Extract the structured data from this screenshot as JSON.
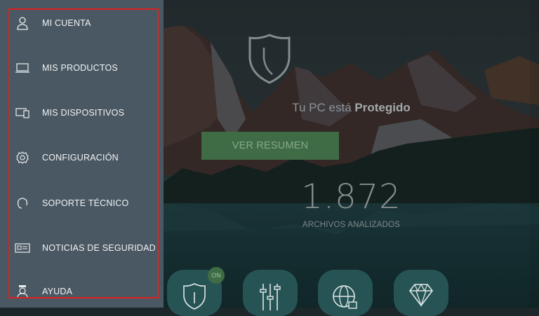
{
  "menu": {
    "items": [
      {
        "label": "MI CUENTA",
        "icon": "user-icon"
      },
      {
        "label": "MIS PRODUCTOS",
        "icon": "laptop-icon"
      },
      {
        "label": "MIS DISPOSITIVOS",
        "icon": "devices-icon"
      },
      {
        "label": "CONFIGURACIÓN",
        "icon": "gear-icon"
      },
      {
        "label": "SOPORTE TÉCNICO",
        "icon": "headset-icon"
      },
      {
        "label": "NOTICIAS DE SEGURIDAD",
        "icon": "news-icon"
      },
      {
        "label": "AYUDA",
        "icon": "help-icon"
      }
    ]
  },
  "status": {
    "prefix": "Tu PC está",
    "state": "Protegido"
  },
  "summary_button": "VER RESUMEN",
  "scan": {
    "count": "1.872",
    "label": "ARCHIVOS ANALIZADOS"
  },
  "tiles": {
    "on_badge": "ON",
    "items": [
      "shield-icon",
      "sliders-icon",
      "globe-lock-icon",
      "diamond-icon"
    ]
  },
  "colors": {
    "sidebar": "#4a5863",
    "highlight_border": "#e01f1f",
    "summary_button": "#3f6b45",
    "tile": "#2a5c5c"
  }
}
